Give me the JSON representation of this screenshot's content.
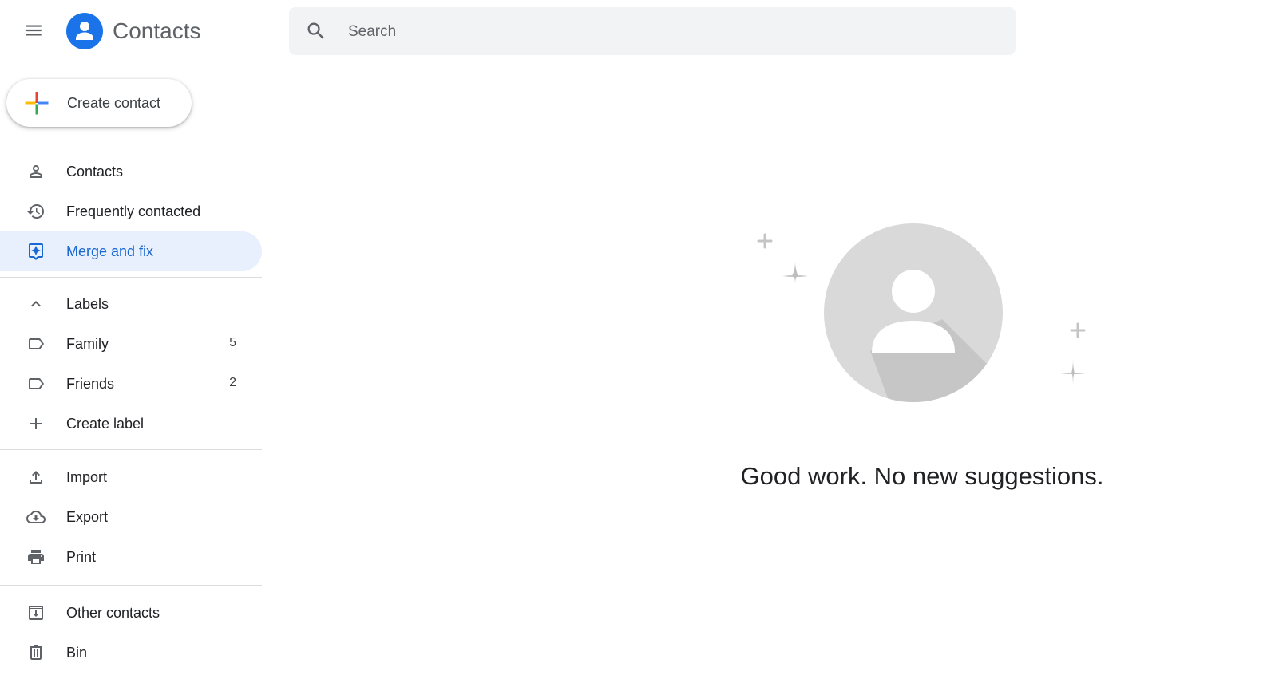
{
  "app": {
    "title": "Contacts"
  },
  "search": {
    "placeholder": "Search"
  },
  "create_button": {
    "label": "Create contact"
  },
  "nav": {
    "contacts": {
      "label": "Contacts"
    },
    "frequently_contacted": {
      "label": "Frequently contacted"
    },
    "merge_and_fix": {
      "label": "Merge and fix"
    }
  },
  "labels": {
    "header": "Labels",
    "items": [
      {
        "label": "Family",
        "count": "5"
      },
      {
        "label": "Friends",
        "count": "2"
      }
    ],
    "create_label": "Create label"
  },
  "actions": {
    "import": "Import",
    "export": "Export",
    "print": "Print"
  },
  "other": {
    "other_contacts": "Other contacts",
    "bin": "Bin"
  },
  "main": {
    "empty_message": "Good work. No new suggestions."
  },
  "colors": {
    "accent": "#1a73e8",
    "active_bg": "#e8f0fe",
    "active_text": "#1967d2",
    "illustration_gray": "#d9d9d9"
  }
}
